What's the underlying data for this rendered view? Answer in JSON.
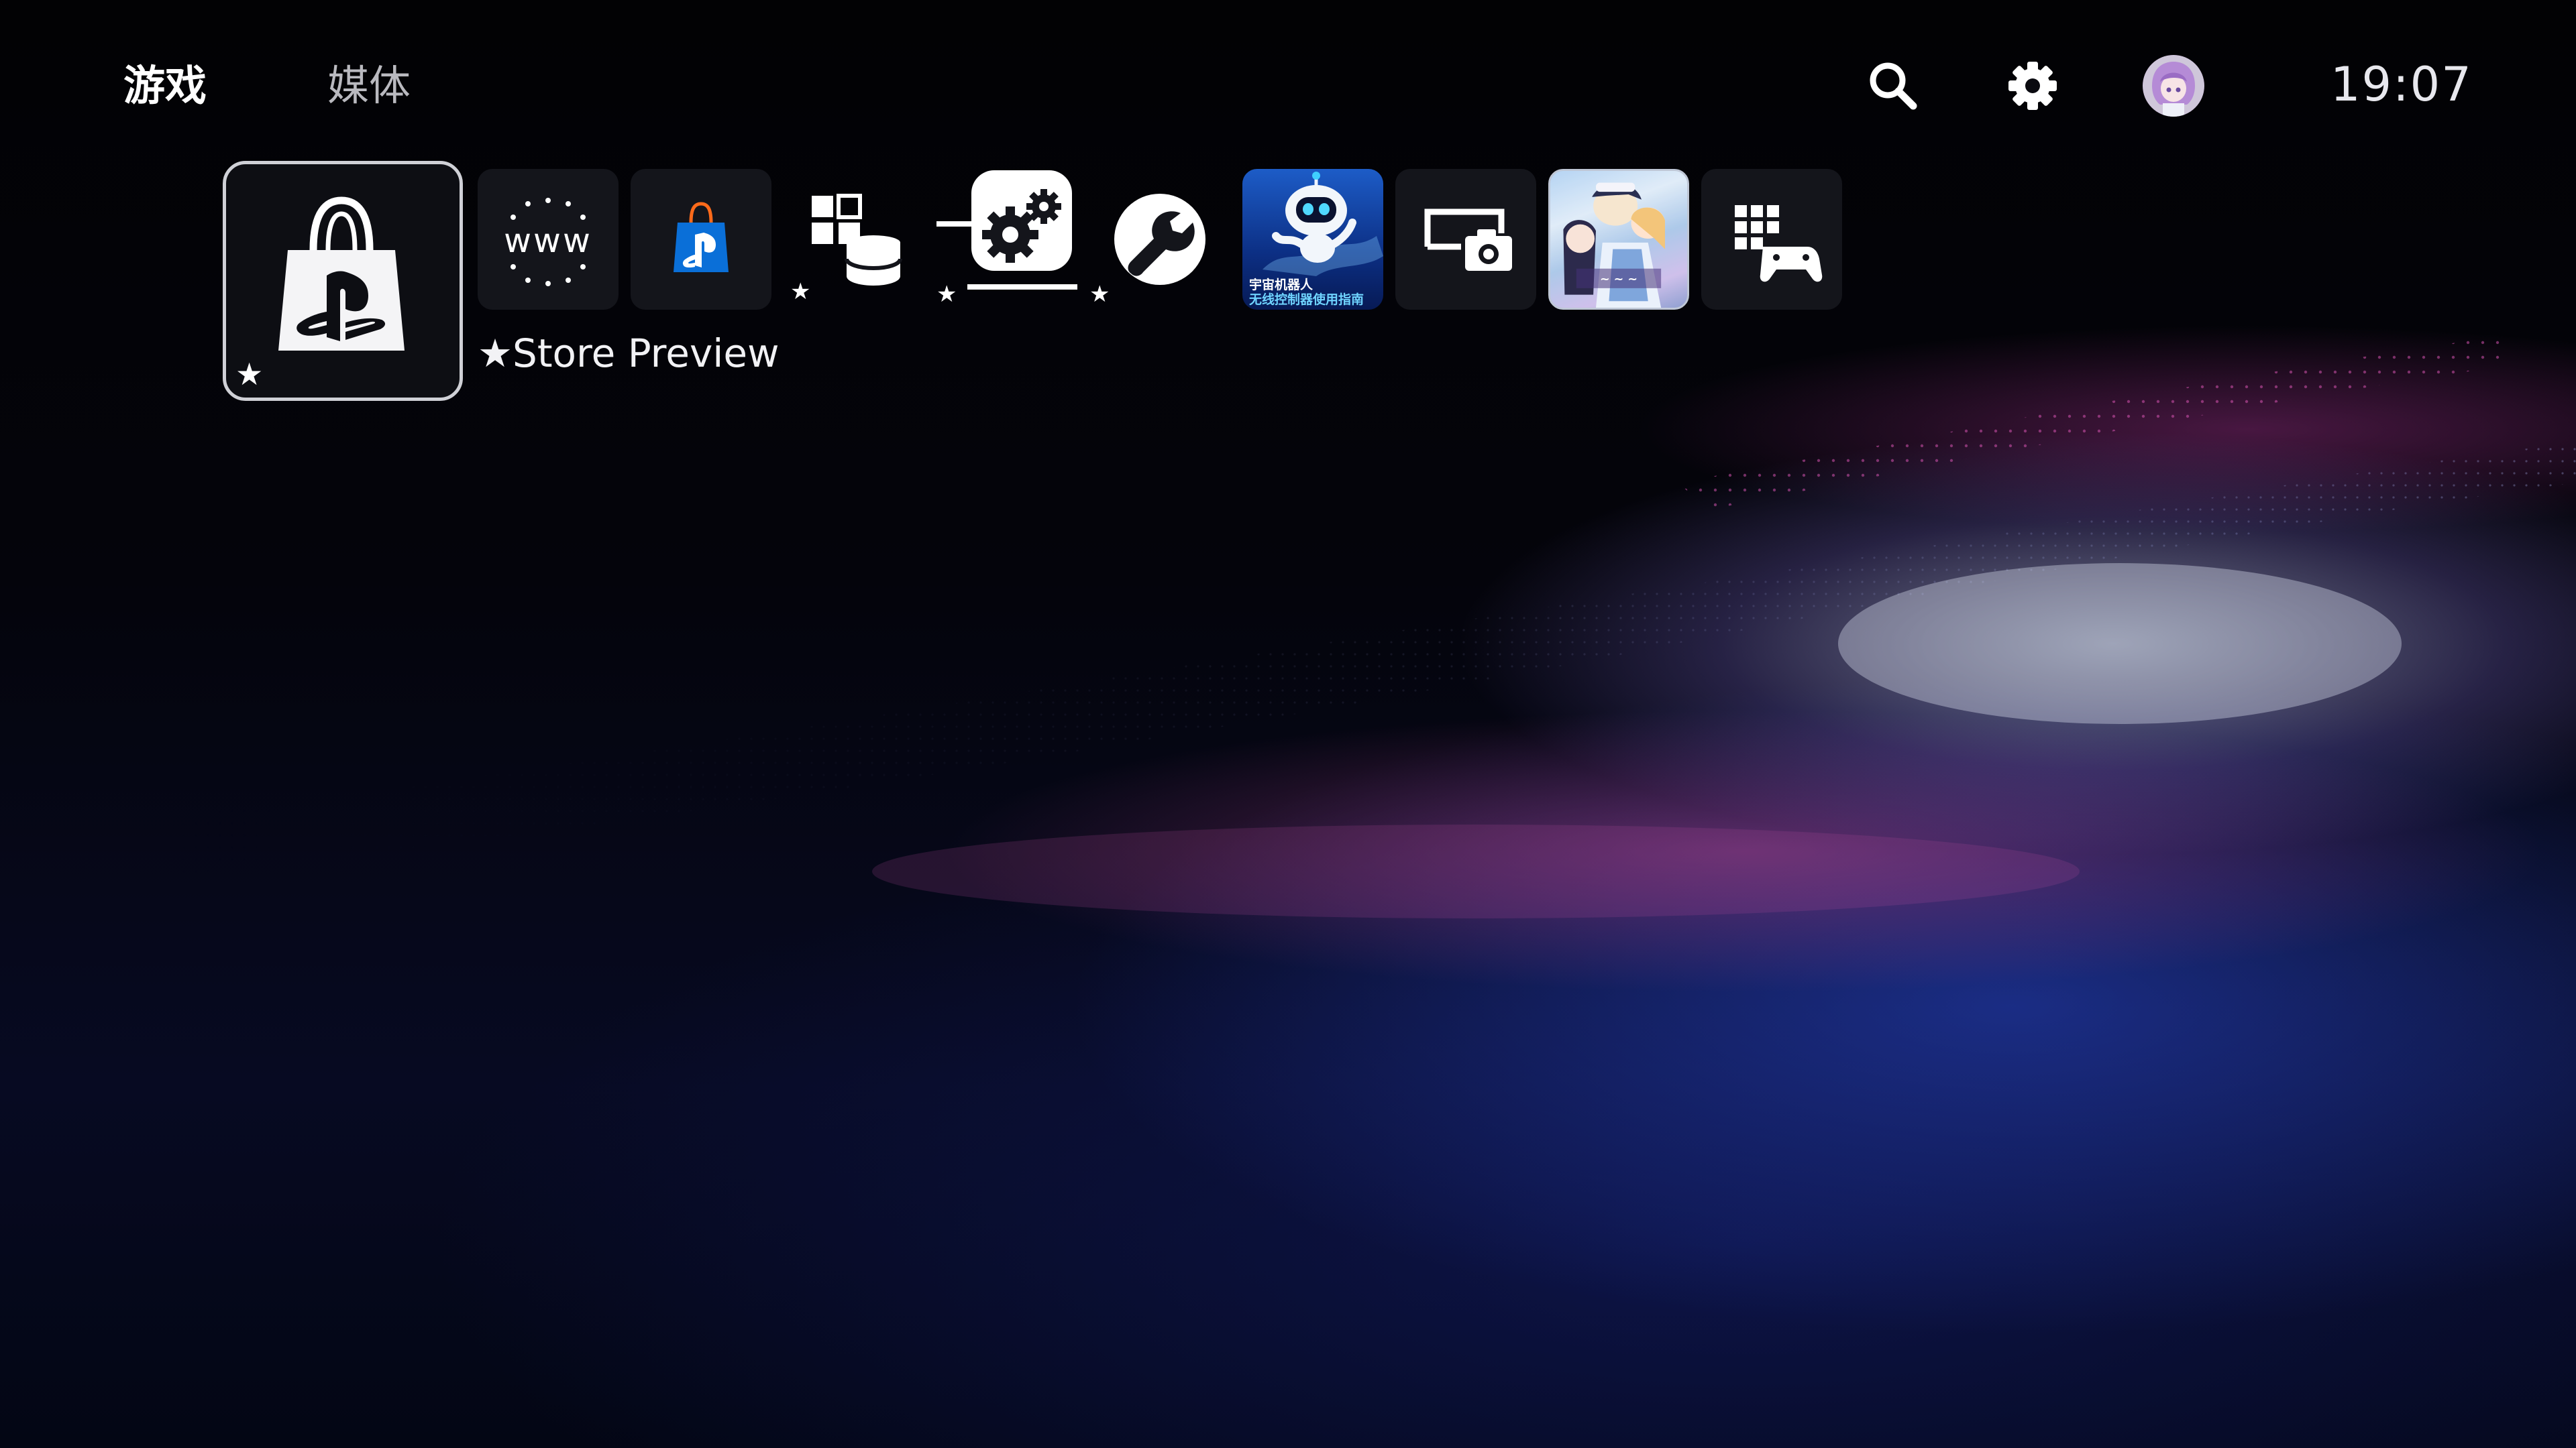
{
  "tabs": [
    {
      "label": "游戏",
      "active": true
    },
    {
      "label": "媒体",
      "active": false
    }
  ],
  "top_icons": [
    "search-icon",
    "gear-icon",
    "avatar"
  ],
  "clock": "19:07",
  "selected_tile": {
    "label": "★Store Preview",
    "favorite": true,
    "icon": "shopping-bag-icon"
  },
  "tiles": [
    {
      "name": "web-browser",
      "icon": "www-icon"
    },
    {
      "name": "playstation-store",
      "icon": "ps-store-bag-icon"
    },
    {
      "name": "data-transfer",
      "icon": "data-blocks-icon",
      "favorite": true
    },
    {
      "name": "system-settings-app",
      "icon": "gears-icon",
      "favorite": true
    },
    {
      "name": "tools",
      "icon": "wrench-icon",
      "favorite": true
    },
    {
      "name": "astros-playroom-guide",
      "icon": "astro-bot-thumbnail",
      "caption_line1": "宇宙机器人",
      "caption_line2": "无线控制器使用指南"
    },
    {
      "name": "capture-gallery",
      "icon": "camera-screen-icon"
    },
    {
      "name": "anime-game",
      "icon": "anime-game-thumbnail"
    },
    {
      "name": "game-library",
      "icon": "library-grid-controller-icon"
    }
  ],
  "colors": {
    "background": "#05050a",
    "tile_bg": "#14151b",
    "selected_border": "#cfd0d6",
    "ps_blue": "#0a6fd8",
    "inactive_tab": "#b9b9bf"
  }
}
